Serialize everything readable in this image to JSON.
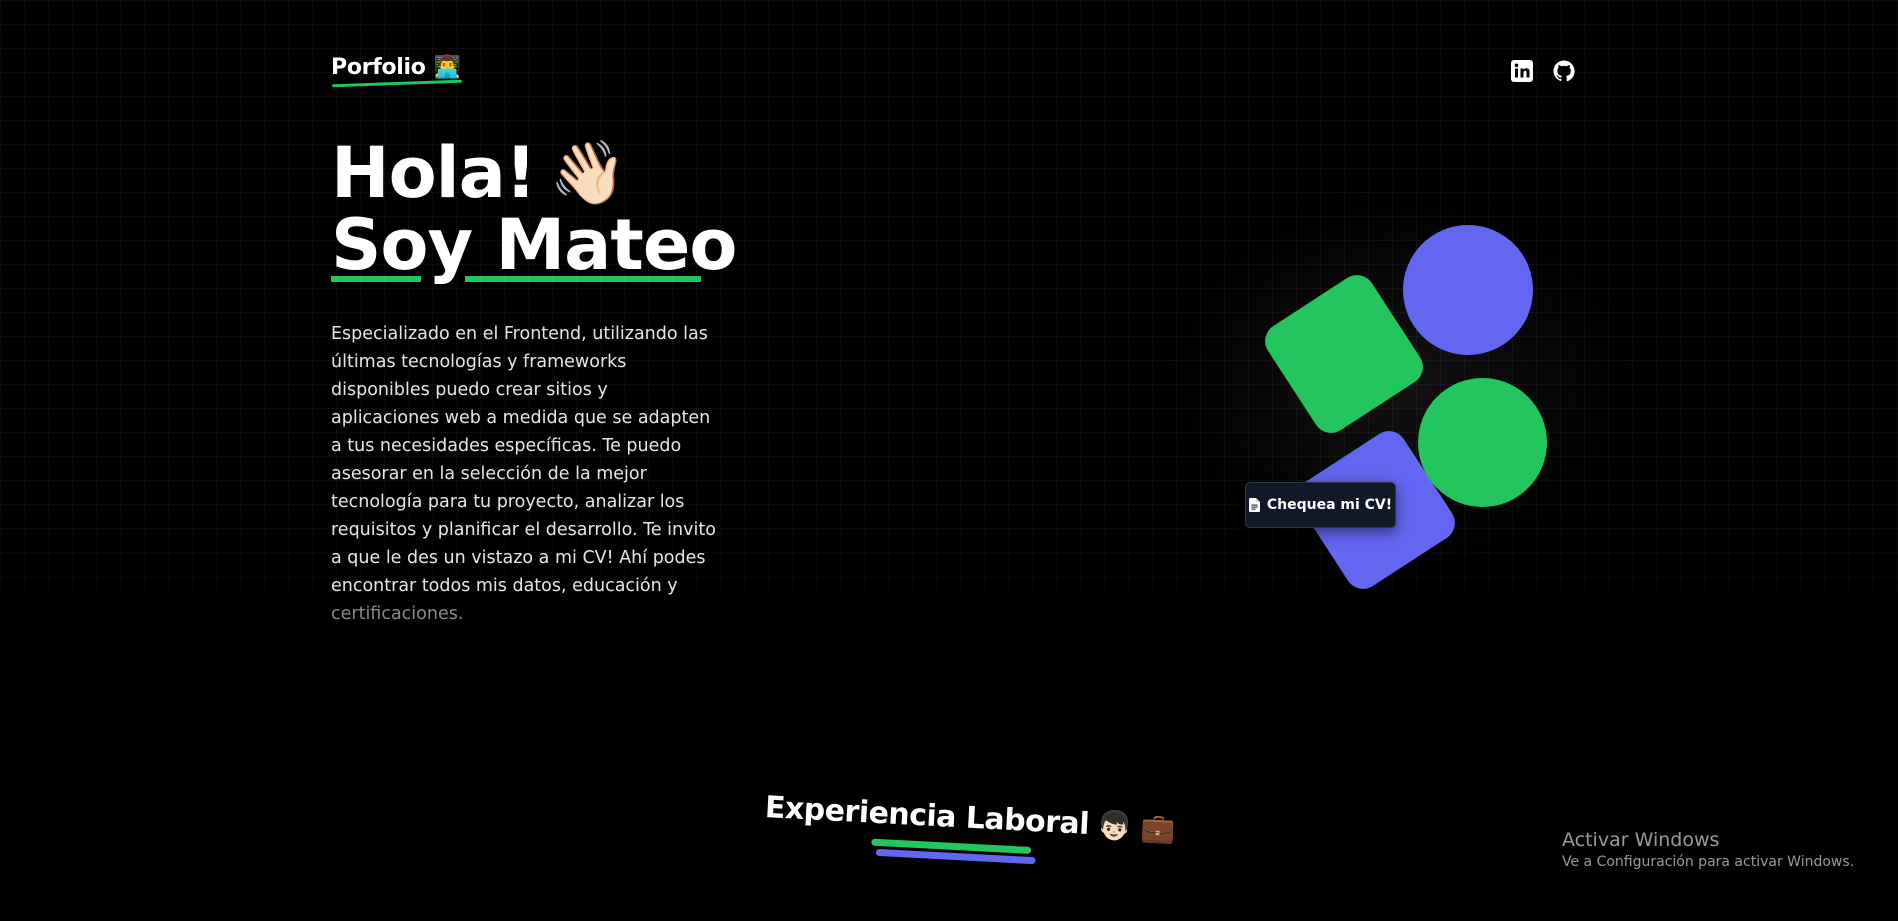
{
  "header": {
    "logo_text": "Porfolio",
    "logo_emoji": "👨‍💻",
    "social_icons": [
      "linkedin-icon",
      "github-icon"
    ]
  },
  "hero": {
    "greeting": "Hola!",
    "greeting_emoji": "👋🏻",
    "name_line": "Soy Mateo",
    "description": "Especializado en el Frontend, utilizando las últimas tecnologías y frameworks disponibles puedo crear sitios y aplicaciones web a medida que se adapten a tus necesidades específicas. Te puedo asesorar en la selección de la mejor tecnología para tu proyecto, analizar los requisitos y planificar el desarrollo. Te invito a que le des un vistazo a mi CV! Ahí podes encontrar todos mis datos, educación y",
    "description_tail": "certificaciones.",
    "cv_button": "Chequea mi CV!",
    "cv_icon": "document-icon"
  },
  "experience": {
    "title": "Experiencia Laboral",
    "emojis": "👦🏻 💼"
  },
  "watermark": {
    "title": "Activar Windows",
    "subtitle": "Ve a Configuración para activar Windows."
  },
  "colors": {
    "background": "#000000",
    "accent_green": "#22c55e",
    "accent_indigo": "#6366f1",
    "button_bg": "#111827"
  }
}
